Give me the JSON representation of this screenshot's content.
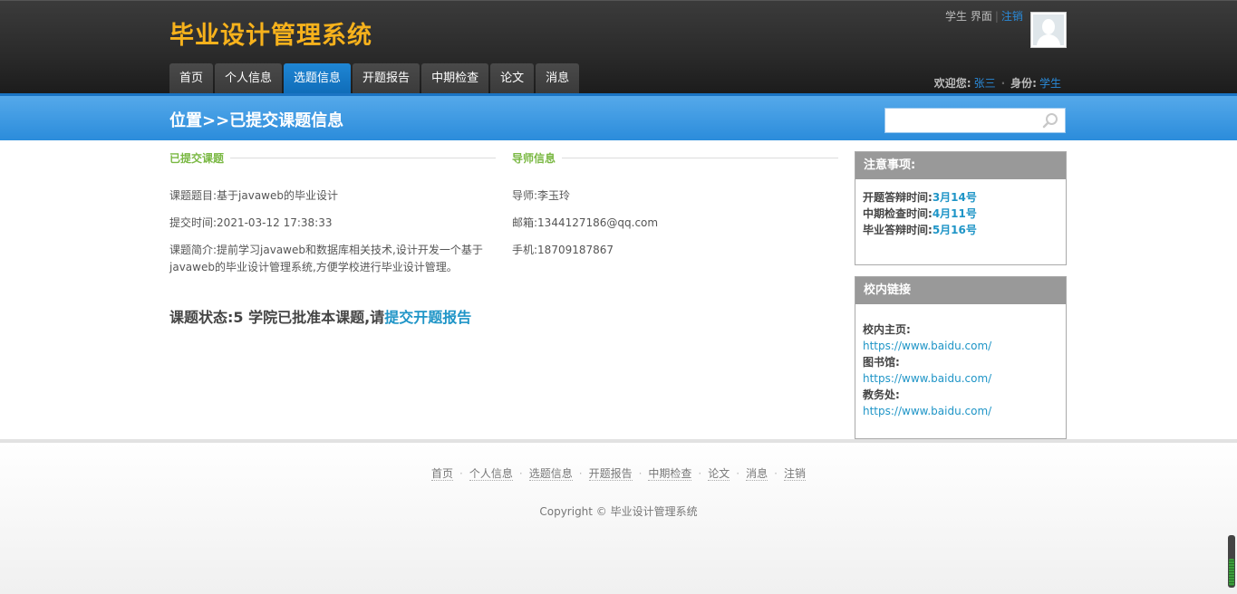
{
  "app": {
    "title": "毕业设计管理系统"
  },
  "user_bar": {
    "role_label": "学生",
    "view_label": "界面",
    "logout": "注销",
    "welcome_label": "欢迎您:",
    "user_name": "张三",
    "identity_label": "身份:",
    "identity": "学生"
  },
  "nav": {
    "items": [
      {
        "label": "首页"
      },
      {
        "label": "个人信息"
      },
      {
        "label": "选题信息"
      },
      {
        "label": "开题报告"
      },
      {
        "label": "中期检查"
      },
      {
        "label": "论文"
      },
      {
        "label": "消息"
      }
    ],
    "active": "选题信息"
  },
  "location": {
    "title": "位置>>已提交课题信息"
  },
  "search": {
    "placeholder": "",
    "icon": "search-icon"
  },
  "topic": {
    "header": "已提交课题",
    "title": "课题题目:基于javaweb的毕业设计",
    "submit_time": "提交时间:2021-03-12 17:38:33",
    "summary": "课题简介:提前学习javaweb和数据库相关技术,设计开发一个基于javaweb的毕业设计管理系统,方便学校进行毕业设计管理。"
  },
  "tutor": {
    "header": "导师信息",
    "name": "导师:李玉玲",
    "email": "邮箱:1344127186@qq.com",
    "phone": "手机:18709187867"
  },
  "status": {
    "text": "课题状态:5 学院已批准本课题,请",
    "link": "提交开题报告"
  },
  "notice": {
    "header": "注意事项:",
    "items": [
      {
        "label": "开题答辩时间:",
        "value": "3月14号"
      },
      {
        "label": "中期检查时间:",
        "value": "4月11号"
      },
      {
        "label": "毕业答辩时间:",
        "value": "5月16号"
      }
    ]
  },
  "links": {
    "header": "校内链接",
    "items": [
      {
        "label": "校内主页:",
        "url": "https://www.baidu.com/"
      },
      {
        "label": "图书馆:",
        "url": "https://www.baidu.com/"
      },
      {
        "label": "教务处:",
        "url": "https://www.baidu.com/"
      }
    ]
  },
  "footer": {
    "links": [
      "首页",
      "个人信息",
      "选题信息",
      "开题报告",
      "中期检查",
      "论文",
      "消息",
      "注销"
    ],
    "separator": "·",
    "copyright": "Copyright © 毕业设计管理系统"
  },
  "colors": {
    "brand_title": "#f7b21c",
    "nav_active": "#1f86d4",
    "band": "#3d9be3",
    "section_header": "#7ab843",
    "link": "#1f95c7"
  }
}
